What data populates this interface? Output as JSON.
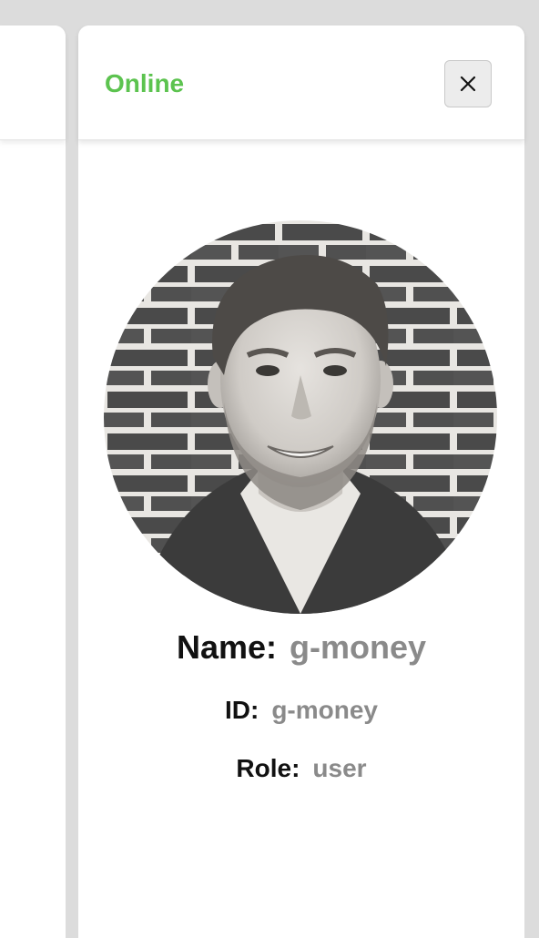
{
  "header": {
    "status": "Online",
    "close_icon": "close-icon"
  },
  "profile": {
    "name_label": "Name:",
    "name_value": "g-money",
    "id_label": "ID:",
    "id_value": "g-money",
    "role_label": "Role:",
    "role_value": "user"
  },
  "colors": {
    "status_online": "#5cc34f",
    "value_text": "#8a8a8a",
    "background": "#dcdcdc"
  }
}
